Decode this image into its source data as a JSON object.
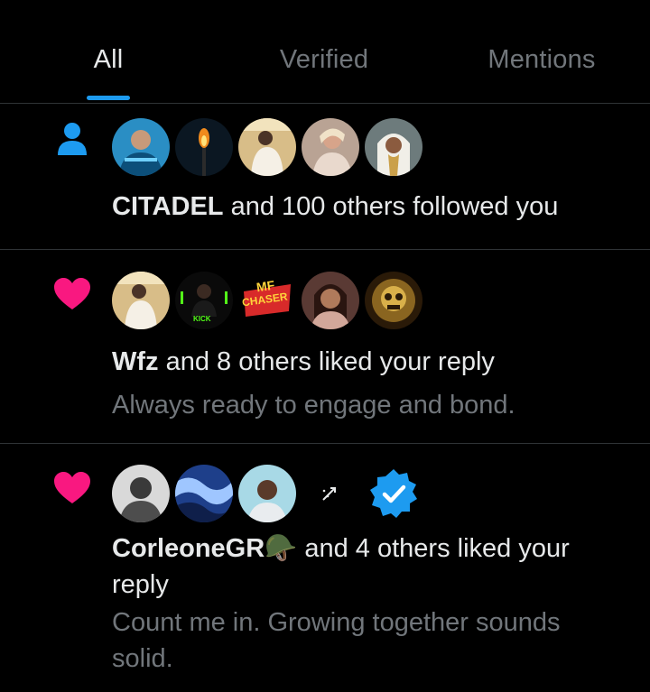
{
  "tabs": [
    {
      "label": "All",
      "active": true
    },
    {
      "label": "Verified",
      "active": false
    },
    {
      "label": "Mentions",
      "active": false
    }
  ],
  "colors": {
    "background": "#000000",
    "accent": "#1d9bf0",
    "like": "#f91880",
    "text_primary": "#e7e9ea",
    "text_secondary": "#71767b",
    "divider": "#2f3336"
  },
  "notifications": [
    {
      "type": "follow",
      "icon": "person-icon",
      "actor": "CITADEL",
      "action": " and 100 others followed you",
      "avatar_count": 5
    },
    {
      "type": "like",
      "icon": "heart-icon",
      "actor": "Wfz",
      "action": " and 8 others liked your reply",
      "snippet": "Always ready to engage and bond.",
      "avatar_count": 5,
      "avatar_badge_text": "KICK",
      "avatar_logo_text_1": "MF",
      "avatar_logo_text_2": "CHASER"
    },
    {
      "type": "like",
      "icon": "heart-icon",
      "actor": "CorleoneGR🪖",
      "action": " and 4 others liked your",
      "action_cont": "reply",
      "snippet_line1": "Count me in. Growing together sounds",
      "snippet_line2": "solid.",
      "avatar_count": 5
    }
  ]
}
